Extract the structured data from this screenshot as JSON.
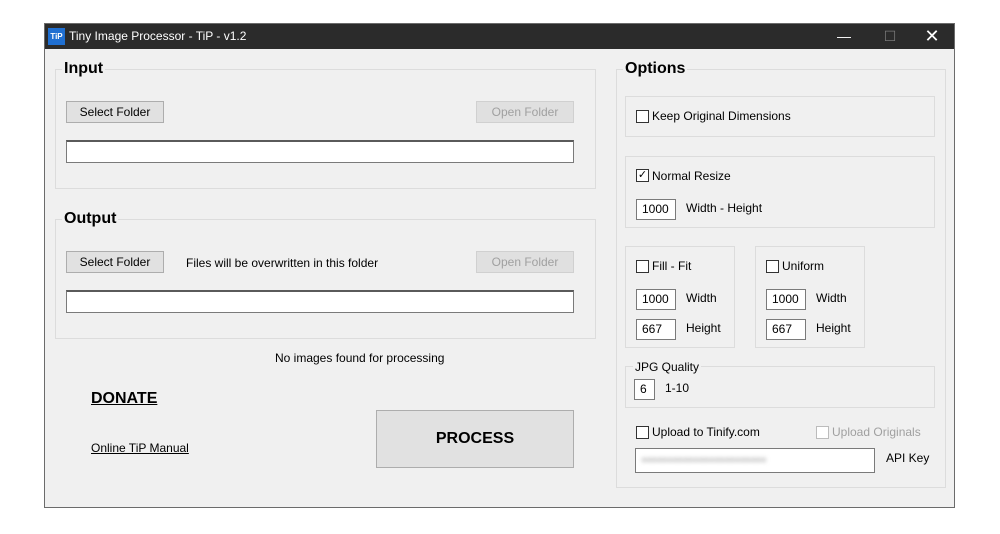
{
  "window": {
    "title": "Tiny Image Processor - TiP - v1.2",
    "icon_text": "TiP",
    "minimize": "—",
    "maximize": "☐",
    "close": "✕"
  },
  "input": {
    "title": "Input",
    "select_folder": "Select Folder",
    "open_folder": "Open Folder",
    "path": ""
  },
  "output": {
    "title": "Output",
    "select_folder": "Select Folder",
    "open_folder": "Open Folder",
    "warning": "Files will be overwritten in this folder",
    "path": ""
  },
  "status": "No images found for processing",
  "donate": "DONATE",
  "manual": "Online TiP Manual",
  "process": "PROCESS",
  "options": {
    "title": "Options",
    "keep_original": {
      "label": "Keep Original Dimensions",
      "checked": false
    },
    "normal_resize": {
      "label": "Normal Resize",
      "checked": true,
      "value": "1000",
      "caption": "Width - Height"
    },
    "fill_fit": {
      "label": "Fill - Fit",
      "checked": false,
      "width": "1000",
      "width_label": "Width",
      "height": "667",
      "height_label": "Height"
    },
    "uniform": {
      "label": "Uniform",
      "checked": false,
      "width": "1000",
      "width_label": "Width",
      "height": "667",
      "height_label": "Height"
    },
    "jpg_quality": {
      "label": "JPG Quality",
      "value": "6",
      "range": "1-10"
    },
    "upload_tinify": {
      "label": "Upload to Tinify.com",
      "checked": false
    },
    "upload_originals": {
      "label": "Upload Originals",
      "checked": false,
      "enabled": false
    },
    "api_key": {
      "label": "API Key",
      "value": "••••••••••••••••••••••••"
    }
  },
  "check_mark": "✓"
}
